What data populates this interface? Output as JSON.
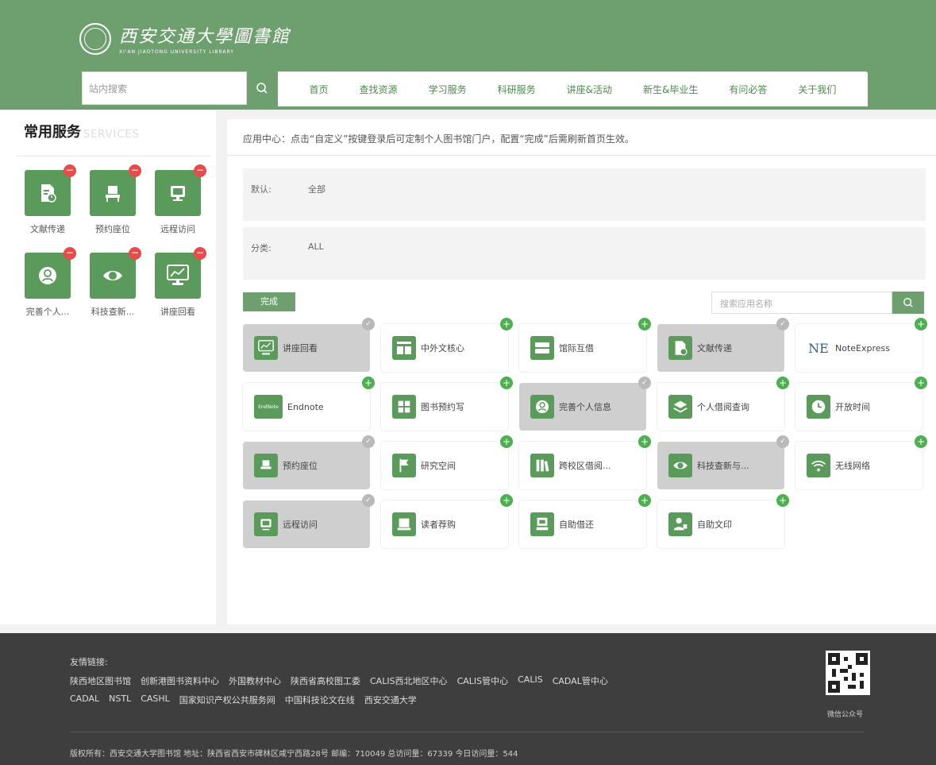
{
  "header": {
    "logo_cn": "西安交通大學圖書館",
    "logo_en": "XI'AN JIAOTONG UNIVERSITY LIBRARY",
    "search_placeholder": "站内搜索",
    "nav": [
      "首页",
      "查找资源",
      "学习服务",
      "科研服务",
      "讲座&活动",
      "新生&毕业生",
      "有问必答",
      "关于我们"
    ]
  },
  "left_panel": {
    "title": "常用服务",
    "title_en": "COMMON SERVICES",
    "services": [
      {
        "label": "文献传递",
        "icon": "document-clock-icon"
      },
      {
        "label": "预约座位",
        "icon": "seat-icon"
      },
      {
        "label": "远程访问",
        "icon": "monitor-icon"
      },
      {
        "label": "完善个人...",
        "icon": "person-icon"
      },
      {
        "label": "科技查新...",
        "icon": "eye-icon"
      },
      {
        "label": "讲座回看",
        "icon": "screen-chart-icon"
      }
    ]
  },
  "main": {
    "intro": "应用中心：点击“自定义”按键登录后可定制个人图书馆门户，配置“完成”后需刷新首页生效。",
    "filter_default_label": "默认:",
    "filter_default_value": "全部",
    "filter_category_label": "分类:",
    "filter_category_value": "ALL",
    "done_label": "完成",
    "app_search_placeholder": "搜索应用名称",
    "apps": [
      {
        "name": "讲座回看",
        "state": "selected",
        "icon": "screen-chart-icon"
      },
      {
        "name": "中外文核心",
        "state": "available",
        "icon": "core-journal-icon"
      },
      {
        "name": "馆际互借",
        "state": "available",
        "icon": "card-icon"
      },
      {
        "name": "文献传递",
        "state": "selected",
        "icon": "document-clock-icon"
      },
      {
        "name": "NoteExpress",
        "state": "available",
        "icon": "ne-icon"
      },
      {
        "name": "Endnote",
        "state": "available",
        "icon": "endnote-icon"
      },
      {
        "name": "图书预约写",
        "state": "available",
        "icon": "book-grid-icon"
      },
      {
        "name": "完善个人信息",
        "state": "selected",
        "icon": "person-icon"
      },
      {
        "name": "个人借阅查询",
        "state": "available",
        "icon": "layers-icon"
      },
      {
        "name": "开放时间",
        "state": "available",
        "icon": "clock-icon"
      },
      {
        "name": "预约座位",
        "state": "selected",
        "icon": "seat-icon"
      },
      {
        "name": "研究空间",
        "state": "available",
        "icon": "flag-icon"
      },
      {
        "name": "跨校区借阅...",
        "state": "available",
        "icon": "books-icon"
      },
      {
        "name": "科技查新与...",
        "state": "selected",
        "icon": "eye-icon"
      },
      {
        "name": "无线网络",
        "state": "available",
        "icon": "wifi-icon"
      },
      {
        "name": "远程访问",
        "state": "selected",
        "icon": "monitor-icon"
      },
      {
        "name": "读者荐购",
        "state": "available",
        "icon": "cart-book-icon"
      },
      {
        "name": "自助借还",
        "state": "available",
        "icon": "kiosk-icon"
      },
      {
        "name": "自助文印",
        "state": "available",
        "icon": "printer-person-icon"
      }
    ]
  },
  "footer": {
    "links_title": "友情链接:",
    "links_row1": [
      "陕西地区图书馆",
      "创新港图书资料中心",
      "外国教材中心",
      "陕西省高校图工委",
      "CALIS西北地区中心",
      "CALIS管中心",
      "CALIS",
      "CADAL管中心"
    ],
    "links_row2": [
      "CADAL",
      "NSTL",
      "CASHL",
      "国家知识产权公共服务网",
      "中国科技论文在线",
      "西安交通大学"
    ],
    "copyright": "版权所有：西安交通大学图书馆   地址：陕西省西安市碑林区咸宁西路28号   邮编：710049   总访问量：67339 今日访问量：544",
    "qr_label": "微信公众号"
  },
  "colors": {
    "brand": "#6e9f6e",
    "tile": "#5a9a5a",
    "remove": "#e94a4a",
    "add": "#4caf50",
    "footer": "#3e3e3e"
  }
}
